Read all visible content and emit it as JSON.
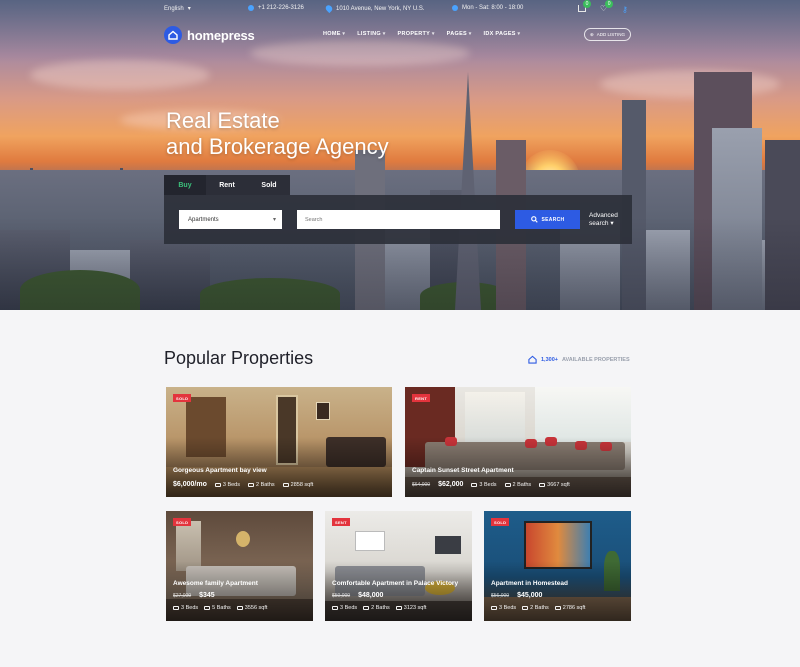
{
  "topbar": {
    "language": "English",
    "phone": "+1 212-226-3126",
    "address": "1010 Avenue, New York, NY U.S.",
    "hours": "Mon - Sat: 8:00 - 18:00",
    "cart_count": "0",
    "wishlist_count": "0"
  },
  "header": {
    "logo": "homepress",
    "nav": [
      "HOME",
      "LISTING",
      "PROPERTY",
      "PAGES",
      "IDX PAGES"
    ],
    "add_listing": "ADD LISTING"
  },
  "hero": {
    "title_line1": "Real Estate",
    "title_line2": "and Brokerage Agency"
  },
  "search": {
    "tabs": [
      "Buy",
      "Rent",
      "Sold"
    ],
    "active_tab": "Buy",
    "type_value": "Apartments",
    "placeholder": "Search",
    "button": "SEARCH",
    "advanced_line1": "Advanced",
    "advanced_line2": "search"
  },
  "popular": {
    "title": "Popular Properties",
    "available_count": "1,300+",
    "available_label": "AVAILABLE PROPERTIES"
  },
  "properties": [
    {
      "tag": "SOLD",
      "name": "Gorgeous Apartment bay view",
      "old_price": "",
      "price": "$6,000/mo",
      "beds": "3 Beds",
      "baths": "2 Baths",
      "sqft": "2858 sqft"
    },
    {
      "tag": "RENT",
      "name": "Captain Sunset Street Apartment",
      "old_price": "$64,000",
      "price": "$62,000",
      "beds": "3 Beds",
      "baths": "2 Baths",
      "sqft": "3667 sqft"
    },
    {
      "tag": "SOLD",
      "name": "Awesome family Apartment",
      "old_price": "$27,000",
      "price": "$345",
      "beds": "3 Beds",
      "baths": "5 Baths",
      "sqft": "3556 sqft"
    },
    {
      "tag": "SENT",
      "name": "Comfortable Apartment in Palace Victory",
      "old_price": "$50,000",
      "price": "$48,000",
      "beds": "3 Beds",
      "baths": "2 Baths",
      "sqft": "3123 sqft"
    },
    {
      "tag": "SOLD",
      "name": "Apartment in Homestead",
      "old_price": "$56,000",
      "price": "$45,000",
      "beds": "3 Beds",
      "baths": "2 Baths",
      "sqft": "2786 sqft"
    }
  ]
}
